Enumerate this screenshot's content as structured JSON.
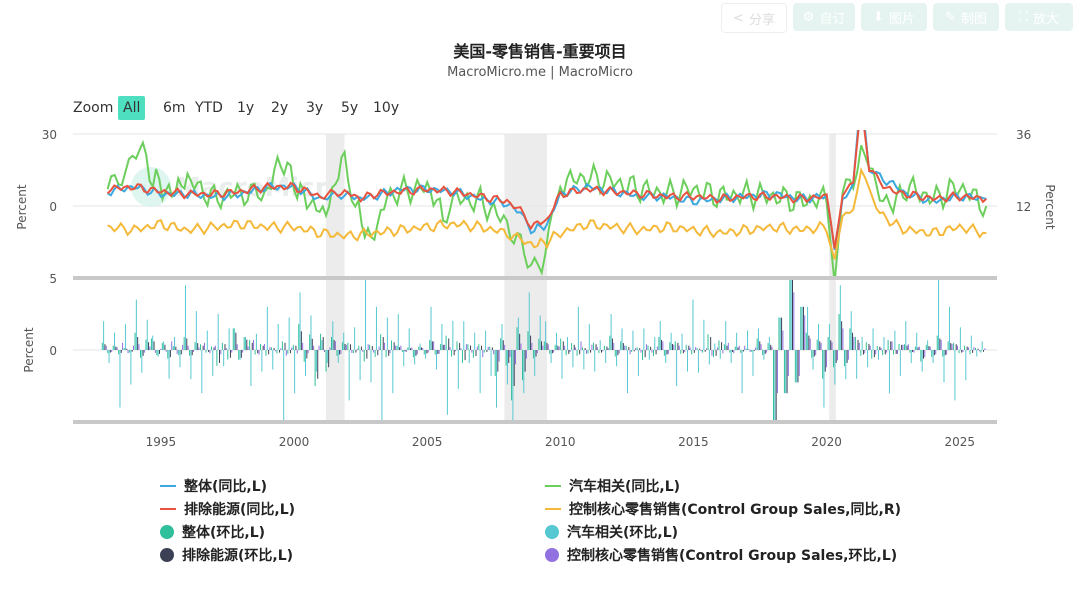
{
  "toolbar": {
    "share": "分享",
    "customize": "自订",
    "image": "图片",
    "draw": "制图",
    "enlarge": "放大"
  },
  "title": "美国-零售销售-重要项目",
  "subtitle": "MacroMicro.me | MacroMicro",
  "zoom": {
    "label": "Zoom",
    "buttons": [
      "All",
      "6m",
      "YTD",
      "1y",
      "2y",
      "3y",
      "5y",
      "10y"
    ],
    "active": "All"
  },
  "chart_data": [
    {
      "type": "line",
      "title": "美国-零售销售-重要项目",
      "ylabel": "Percent",
      "ylabel_right": "Percent",
      "ylim": [
        -30,
        30
      ],
      "ylim_right": [
        0,
        36
      ],
      "yticks": [
        "30",
        "0"
      ],
      "yticks_right": [
        "36",
        "12"
      ],
      "recessions": [
        [
          2001.2,
          2001.9
        ],
        [
          2007.9,
          2009.5
        ],
        [
          2020.1,
          2020.35
        ]
      ],
      "series": [
        {
          "name": "整体(同比,L)",
          "color": "#3ba9e0",
          "axis": "L",
          "points": [
            [
              1993,
              6
            ],
            [
              1994,
              8
            ],
            [
              1995,
              5
            ],
            [
              1996,
              5
            ],
            [
              1997,
              4
            ],
            [
              1998,
              5
            ],
            [
              1999,
              8
            ],
            [
              2000,
              8
            ],
            [
              2001,
              3
            ],
            [
              2001.9,
              5
            ],
            [
              2002.5,
              3
            ],
            [
              2003,
              4
            ],
            [
              2004,
              7
            ],
            [
              2005,
              7
            ],
            [
              2006,
              6
            ],
            [
              2007,
              3
            ],
            [
              2008,
              1
            ],
            [
              2008.5,
              -3
            ],
            [
              2008.9,
              -10
            ],
            [
              2009.5,
              -8
            ],
            [
              2010,
              5
            ],
            [
              2011,
              8
            ],
            [
              2012,
              6
            ],
            [
              2013,
              4
            ],
            [
              2014,
              4
            ],
            [
              2015,
              2
            ],
            [
              2016,
              3
            ],
            [
              2017,
              4
            ],
            [
              2018,
              5
            ],
            [
              2019,
              3
            ],
            [
              2020,
              4
            ],
            [
              2020.3,
              -20
            ],
            [
              2020.6,
              4
            ],
            [
              2021,
              8
            ],
            [
              2021.3,
              48
            ],
            [
              2021.6,
              15
            ],
            [
              2022,
              12
            ],
            [
              2022.5,
              9
            ],
            [
              2023,
              5
            ],
            [
              2024,
              2
            ],
            [
              2025,
              4
            ],
            [
              2026,
              3
            ]
          ]
        },
        {
          "name": "排除能源(同比,L)",
          "color": "#e8533f",
          "axis": "L",
          "points": [
            [
              1993,
              7
            ],
            [
              1994,
              8
            ],
            [
              1995,
              6
            ],
            [
              1996,
              5
            ],
            [
              1997,
              5
            ],
            [
              1998,
              6
            ],
            [
              1999,
              8
            ],
            [
              2000,
              8
            ],
            [
              2001,
              4
            ],
            [
              2001.9,
              6
            ],
            [
              2002.5,
              3
            ],
            [
              2003,
              5
            ],
            [
              2004,
              6
            ],
            [
              2005,
              7
            ],
            [
              2006,
              6
            ],
            [
              2007,
              4
            ],
            [
              2008,
              2
            ],
            [
              2008.5,
              -2
            ],
            [
              2008.9,
              -8
            ],
            [
              2009.5,
              -6
            ],
            [
              2010,
              5
            ],
            [
              2011,
              7
            ],
            [
              2012,
              6
            ],
            [
              2013,
              5
            ],
            [
              2014,
              4
            ],
            [
              2015,
              4
            ],
            [
              2016,
              3
            ],
            [
              2017,
              4
            ],
            [
              2018,
              4
            ],
            [
              2019,
              3
            ],
            [
              2020,
              4
            ],
            [
              2020.3,
              -18
            ],
            [
              2020.6,
              6
            ],
            [
              2021,
              9
            ],
            [
              2021.3,
              45
            ],
            [
              2021.6,
              15
            ],
            [
              2022,
              10
            ],
            [
              2022.5,
              6
            ],
            [
              2023,
              5
            ],
            [
              2024,
              3
            ],
            [
              2025,
              4
            ],
            [
              2026,
              3
            ]
          ]
        },
        {
          "name": "汽车相关(同比,L)",
          "color": "#6ccf5c",
          "axis": "L",
          "points": [
            [
              1993,
              10
            ],
            [
              1993.8,
              16
            ],
            [
              1994.2,
              25
            ],
            [
              1994.7,
              12
            ],
            [
              1995.3,
              5
            ],
            [
              1996,
              11
            ],
            [
              1997,
              3
            ],
            [
              1998,
              6
            ],
            [
              1998.9,
              4
            ],
            [
              1999.5,
              20
            ],
            [
              2000,
              9
            ],
            [
              2000.6,
              1
            ],
            [
              2001.2,
              -3
            ],
            [
              2001.9,
              22
            ],
            [
              2002.3,
              0
            ],
            [
              2002.9,
              -15
            ],
            [
              2003.5,
              4
            ],
            [
              2004,
              6
            ],
            [
              2005,
              8
            ],
            [
              2005.6,
              -3
            ],
            [
              2006,
              3
            ],
            [
              2007,
              2
            ],
            [
              2008,
              -7
            ],
            [
              2008.9,
              -25
            ],
            [
              2009.3,
              -22
            ],
            [
              2009.7,
              -5
            ],
            [
              2010,
              10
            ],
            [
              2011,
              12
            ],
            [
              2012,
              10
            ],
            [
              2013,
              7
            ],
            [
              2014,
              5
            ],
            [
              2015,
              7
            ],
            [
              2016,
              4
            ],
            [
              2017,
              5
            ],
            [
              2018,
              4
            ],
            [
              2019,
              2
            ],
            [
              2020,
              3
            ],
            [
              2020.3,
              -30
            ],
            [
              2020.6,
              8
            ],
            [
              2021,
              10
            ],
            [
              2021.3,
              30
            ],
            [
              2021.6,
              12
            ],
            [
              2022,
              5
            ],
            [
              2022.5,
              0
            ],
            [
              2023,
              8
            ],
            [
              2024,
              3
            ],
            [
              2025,
              8
            ],
            [
              2026,
              0
            ]
          ]
        },
        {
          "name": "控制核心零售销售(Control Group Sales,同比,R)",
          "color": "#f5b93a",
          "axis": "R",
          "points": [
            [
              1993,
              5
            ],
            [
              1994,
              4
            ],
            [
              1995,
              6
            ],
            [
              1996,
              4
            ],
            [
              1997,
              5
            ],
            [
              1998,
              6
            ],
            [
              1999,
              5
            ],
            [
              2000,
              5
            ],
            [
              2001,
              3
            ],
            [
              2002,
              2
            ],
            [
              2003,
              3
            ],
            [
              2004,
              4
            ],
            [
              2005,
              5
            ],
            [
              2006,
              6
            ],
            [
              2007,
              5
            ],
            [
              2008,
              3
            ],
            [
              2008.9,
              -1
            ],
            [
              2009.5,
              0
            ],
            [
              2010,
              3
            ],
            [
              2011,
              6
            ],
            [
              2012,
              5
            ],
            [
              2013,
              4
            ],
            [
              2014,
              5
            ],
            [
              2015,
              4
            ],
            [
              2016,
              3
            ],
            [
              2017,
              4
            ],
            [
              2018,
              5
            ],
            [
              2019,
              4
            ],
            [
              2020,
              5
            ],
            [
              2020.3,
              -6
            ],
            [
              2020.6,
              8
            ],
            [
              2021,
              12
            ],
            [
              2021.3,
              24
            ],
            [
              2021.6,
              16
            ],
            [
              2022,
              10
            ],
            [
              2022.5,
              6
            ],
            [
              2023,
              4
            ],
            [
              2024,
              3
            ],
            [
              2025,
              5
            ],
            [
              2026,
              3
            ]
          ]
        }
      ]
    },
    {
      "type": "bar",
      "ylabel": "Percent",
      "ylim": [
        -5,
        5
      ],
      "yticks": [
        "5",
        "0"
      ],
      "xticks": [
        "1995",
        "2000",
        "2005",
        "2010",
        "2015",
        "2020",
        "2025"
      ],
      "xlim": [
        1991.7,
        2026.4
      ],
      "series": [
        {
          "name": "整体(环比,L)",
          "color": "#2fbf9b",
          "values": [
            0.5,
            -0.3,
            1.2,
            0.8,
            -0.6,
            0.9,
            0.4,
            -1.1,
            1.5,
            0.7,
            -0.4,
            0.6,
            1.8,
            -2.5,
            0.9,
            0.5,
            -0.8,
            1.1,
            0.3,
            -0.5,
            0.7,
            1.0,
            -0.9,
            0.4,
            -1.8,
            -3.5,
            1.3,
            0.6,
            0.8,
            -0.4,
            0.5,
            1.0,
            0.3,
            -0.7,
            0.9,
            0.6,
            -0.3,
            1.1,
            0.4,
            -0.2,
            0.8,
            -5,
            5,
            1.2,
            -2.0,
            2.5,
            0.9,
            -0.6,
            0.7,
            0.4,
            -0.8,
            1.0,
            0.5,
            -0.3
          ]
        },
        {
          "name": "汽车相关(环比,L)",
          "color": "#55c8d2",
          "values": [
            2.0,
            -4.0,
            3.5,
            1.0,
            -2.0,
            4.5,
            -3.0,
            2.5,
            1.5,
            -2.5,
            3.0,
            -5.0,
            4.0,
            -1.5,
            2.0,
            -3.5,
            5.0,
            -5.0,
            2.5,
            -1.0,
            3.0,
            -4.5,
            2.0,
            -3.0,
            -4.0,
            -5.0,
            4.0,
            2.0,
            -2.0,
            3.0,
            -1.5,
            2.5,
            -3.0,
            1.5,
            2.0,
            -2.5,
            3.5,
            -1.0,
            2.0,
            -3.0,
            1.5,
            -5.0,
            5.0,
            3.0,
            -4.0,
            4.5,
            -2.0,
            1.5,
            -3.0,
            2.0,
            -1.5,
            5.0,
            -3.5,
            1.0
          ]
        },
        {
          "name": "排除能源(环比,L)",
          "color": "#3b4054",
          "values": [
            0.4,
            -0.2,
            0.9,
            0.6,
            -0.5,
            0.8,
            0.3,
            -0.9,
            1.2,
            0.5,
            -0.3,
            0.5,
            1.3,
            -2.0,
            0.7,
            0.4,
            -0.6,
            0.9,
            0.2,
            -0.4,
            0.6,
            0.8,
            -0.7,
            0.3,
            -1.5,
            -2.5,
            1.0,
            0.5,
            0.6,
            -0.3,
            0.4,
            0.8,
            0.2,
            -0.5,
            0.7,
            0.5,
            -0.2,
            0.9,
            0.3,
            -0.1,
            0.6,
            -5,
            5,
            1.0,
            -1.5,
            2.0,
            0.7,
            -0.5,
            0.6,
            0.3,
            -0.6,
            0.8,
            0.4,
            -0.2
          ]
        },
        {
          "name": "控制核心零售销售(Control Group Sales,环比,L)",
          "color": "#9170e0",
          "values": [
            0.3,
            0.5,
            0.4,
            -0.2,
            0.6,
            0.3,
            0.5,
            -0.3,
            0.4,
            0.7,
            0.2,
            -0.4,
            0.5,
            0.3,
            0.6,
            -0.2,
            0.4,
            0.5,
            0.3,
            -0.3,
            0.6,
            0.2,
            0.4,
            -0.5,
            -0.8,
            -1.0,
            0.5,
            0.4,
            0.3,
            0.6,
            0.2,
            0.5,
            -0.3,
            0.4,
            0.6,
            0.3,
            0.2,
            -0.4,
            0.5,
            0.3,
            0.4,
            -3.0,
            4.0,
            0.8,
            -1.2,
            1.5,
            0.5,
            -0.3,
            0.6,
            0.4,
            -0.5,
            0.7,
            0.3,
            0.2
          ]
        }
      ]
    }
  ],
  "legend": [
    "整体(同比,L)",
    "排除能源(同比,L)",
    "整体(环比,L)",
    "排除能源(环比,L)",
    "汽车相关(同比,L)",
    "控制核心零售销售(Control Group Sales,同比,R)",
    "汽车相关(环比,L)",
    "控制核心零售销售(Control Group Sales,环比,L)"
  ],
  "watermark": "MacroMicro"
}
